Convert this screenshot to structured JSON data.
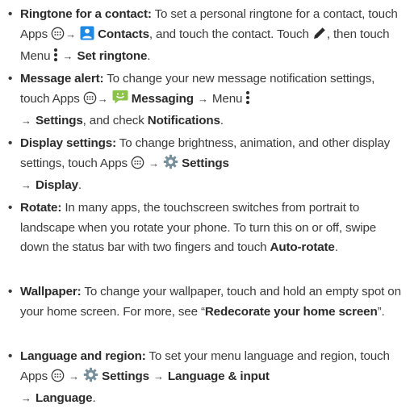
{
  "items": [
    {
      "title": "Ringtone for a contact:",
      "t1": " To set a personal ringtone for a contact, touch Apps ",
      "t2": " Contacts",
      "t3": ", and touch the contact. Touch ",
      "t4": ", then touch Menu ",
      "t5": "Set ringtone",
      "t6": "."
    },
    {
      "title": "Message alert:",
      "t1": " To change your new message notification settings, touch Apps ",
      "t2": " Messaging",
      "t3": " Menu ",
      "t4": "Settings",
      "t5": ", and check ",
      "t6": "Notifications",
      "t7": "."
    },
    {
      "title": "Display settings:",
      "t1": " To change brightness, animation, and other display settings, touch Apps ",
      "t2": " Settings",
      "t3": "Display",
      "t4": "."
    },
    {
      "title": "Rotate:",
      "t1": " In many apps, the touchscreen switches from portrait to landscape when you rotate your phone. To turn this on or off, swipe down the status bar with two fingers and touch ",
      "t2": "Auto-rotate",
      "t3": "."
    },
    {
      "title": "Wallpaper:",
      "t1": " To change your wallpaper, touch and hold an empty spot on your home screen. For more, see “",
      "t2": "Redecorate your home screen",
      "t3": "”."
    },
    {
      "title": "Language and region:",
      "t1": " To set your menu language and region, touch Apps ",
      "t2": " Settings",
      "t3": "Language & input",
      "t4": "Language",
      "t5": "."
    }
  ],
  "bullet": "•",
  "arrow": "→",
  "colors": {
    "text": "#3a3a3a",
    "contacts_icon": "#1e88e5",
    "messaging_icon": "#8bc34a",
    "settings_icon": "#78909c"
  },
  "icons": [
    "apps-icon",
    "contacts-icon",
    "edit-pencil-icon",
    "menu-icon",
    "messaging-icon",
    "settings-icon"
  ]
}
